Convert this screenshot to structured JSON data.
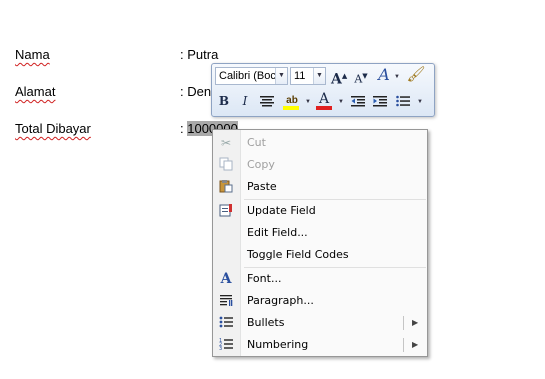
{
  "document": {
    "rows": [
      {
        "label": "Nama",
        "value": ": Putra"
      },
      {
        "label": "Alamat",
        "value": ": Den"
      },
      {
        "label": "Total Dibayar",
        "value_prefix": ": ",
        "value_selected": "1000000"
      }
    ]
  },
  "mini_toolbar": {
    "font_name": "Calibri (Boc",
    "font_size": "11",
    "buttons": {
      "grow_font": "A",
      "shrink_font": "A",
      "styles": "A",
      "bold": "B",
      "italic": "I",
      "font_color": "A"
    },
    "colors": {
      "highlight": "#ffff00",
      "font_color": "#e02020"
    }
  },
  "context_menu": {
    "cut": "Cut",
    "copy": "Copy",
    "paste": "Paste",
    "update_field": "Update Field",
    "edit_field": "Edit Field...",
    "toggle_field_codes": "Toggle Field Codes",
    "font": "Font...",
    "paragraph": "Paragraph...",
    "bullets": "Bullets",
    "numbering": "Numbering"
  }
}
